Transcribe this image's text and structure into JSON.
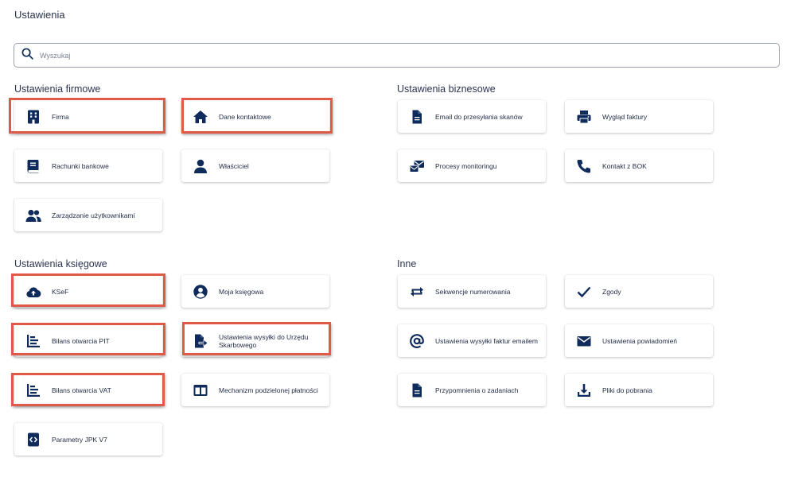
{
  "page": {
    "title": "Ustawienia"
  },
  "search": {
    "placeholder": "Wyszukaj"
  },
  "sections": {
    "firmowe": "Ustawienia firmowe",
    "biznesowe": "Ustawienia biznesowe",
    "ksiegowe": "Ustawienia księgowe",
    "inne": "Inne"
  },
  "cards": {
    "firma": "Firma",
    "dane_kontaktowe": "Dane kontaktowe",
    "rachunki_bankowe": "Rachunki bankowe",
    "wlasciciel": "Właściciel",
    "zarzadzanie_uzytkownikami": "Zarządzanie użytkownikami",
    "email_skanow": "Email do przesyłania skanów",
    "wyglad_faktury": "Wygląd faktury",
    "procesy_monitoringu": "Procesy monitoringu",
    "kontakt_bok": "Kontakt z BOK",
    "ksef": "KSeF",
    "moja_ksiegowa": "Moja księgowa",
    "bilans_pit": "Bilans otwarcia PIT",
    "wysylka_us": "Ustawienia wysyłki do Urzędu Skarbowego",
    "bilans_vat": "Bilans otwarcia VAT",
    "mechanizm_platnosci": "Mechanizm podzielonej płatności",
    "parametry_jpk": "Parametry JPK V7",
    "sekwencje": "Sekwencje numerowania",
    "zgody": "Zgody",
    "wysylka_email": "Ustawienia wysyłki faktur emailem",
    "powiadomienia": "Ustawienia powiadomień",
    "przypomnienia": "Przypomnienia o zadaniach",
    "pliki": "Pliki do pobrania"
  },
  "icons": {
    "firma": "building-icon",
    "dane_kontaktowe": "home-icon",
    "rachunki_bankowe": "bank-book-icon",
    "wlasciciel": "person-icon",
    "zarzadzanie_uzytkownikami": "people-icon",
    "email_skanow": "document-icon",
    "wyglad_faktury": "printer-icon",
    "procesy_monitoringu": "mail-monitor-icon",
    "kontakt_bok": "phone-icon",
    "ksef": "cloud-upload-icon",
    "moja_ksiegowa": "account-circle-icon",
    "bilans_pit": "chart-bars-icon",
    "wysylka_us": "file-send-icon",
    "bilans_vat": "chart-bars-icon",
    "mechanizm_platnosci": "split-columns-icon",
    "parametry_jpk": "code-file-icon",
    "sekwencje": "repeat-arrows-icon",
    "zgody": "check-icon",
    "wysylka_email": "at-sign-icon",
    "powiadomienia": "envelope-icon",
    "przypomnienia": "document-icon",
    "pliki": "download-icon"
  },
  "colors": {
    "icon_navy": "#0f2b5b",
    "highlight_red": "#e05a47",
    "text": "#1f2a44"
  }
}
